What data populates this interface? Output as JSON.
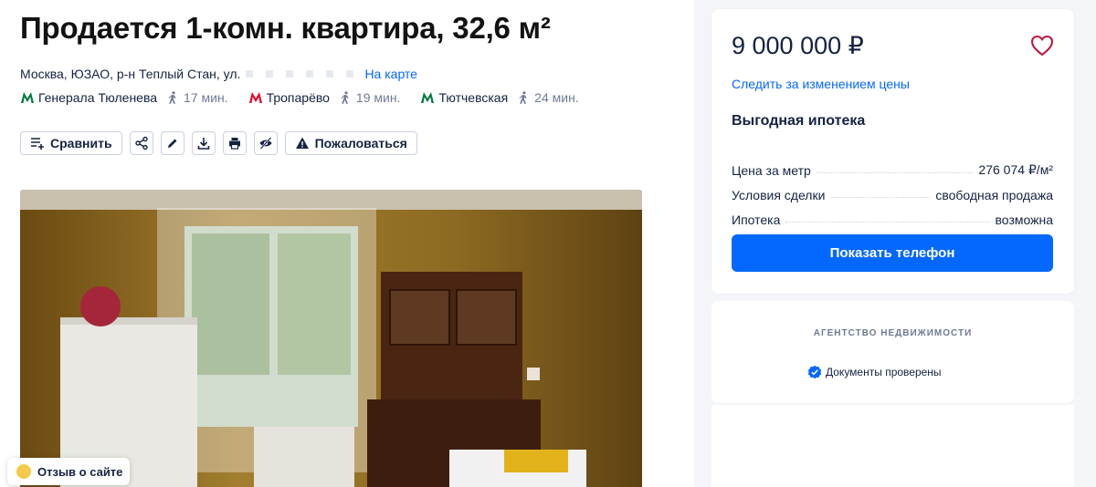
{
  "listing": {
    "title": "Продается 1-комн. квартира, 32,6 м²",
    "address": "Москва, ЮЗАО, р-н Теплый Стан, ул.",
    "map_link": "На карте",
    "metro": [
      {
        "name": "Генерала Тюленева",
        "time": "17 мин.",
        "color": "#007A3D"
      },
      {
        "name": "Тропарёво",
        "time": "19 мин.",
        "color": "#E4002B"
      },
      {
        "name": "Тютчевская",
        "time": "24 мин.",
        "color": "#007A3D"
      }
    ]
  },
  "toolbar": {
    "compare_label": "Сравнить",
    "report_label": "Пожаловаться",
    "icons": [
      "share-icon",
      "edit-icon",
      "download-icon",
      "print-icon",
      "hide-icon"
    ]
  },
  "feedback": {
    "label": "Отзыв о сайте"
  },
  "price_card": {
    "price": "9 000 000 ₽",
    "watch_link": "Следить за изменением цены",
    "mortgage_title": "Выгодная ипотека",
    "rows": [
      {
        "label": "Цена за метр",
        "value": "276 074 ₽/м²"
      },
      {
        "label": "Условия сделки",
        "value": "свободная продажа"
      },
      {
        "label": "Ипотека",
        "value": "возможна"
      }
    ],
    "phone_button": "Показать телефон"
  },
  "agency_card": {
    "label": "АГЕНТСТВО НЕДВИЖИМОСТИ",
    "docs_verified": "Документы проверены"
  },
  "colors": {
    "accent": "#0468ff",
    "text": "#152242",
    "muted": "#707a95"
  }
}
